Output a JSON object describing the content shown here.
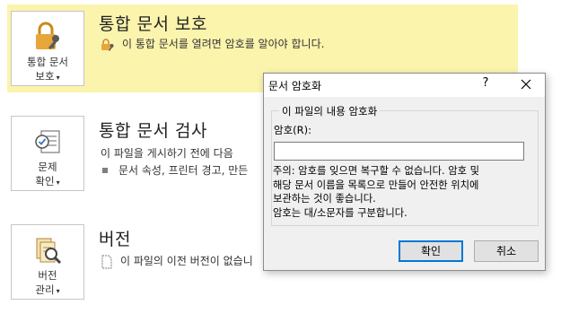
{
  "protect": {
    "tile_line1": "통합 문서",
    "tile_line2": "보호",
    "title": "통합 문서 보호",
    "description": "이 통합 문서를 열려면 암호를 알아야 합니다."
  },
  "inspect": {
    "tile_line1": "문제",
    "tile_line2": "확인",
    "title": "통합 문서 검사",
    "description": "이 파일을 게시하기 전에 다음",
    "bullet": "문서 속성, 프린터 경고, 만든"
  },
  "versions": {
    "tile_line1": "버전",
    "tile_line2": "관리",
    "title": "버전",
    "description": "이 파일의 이전 버전이 없습니"
  },
  "caret": "▾",
  "dialog": {
    "title": "문서 암호화",
    "help": "?",
    "group_label": "이 파일의 내용 암호화",
    "password_label": "암호(R):",
    "password_value": "",
    "note_line1": "주의: 암호를 잊으면 복구할 수 없습니다. 암호 및",
    "note_line2": "해당 문서 이름을 목록으로 만들어 안전한 위치에",
    "note_line3": "보관하는 것이 좋습니다.",
    "note_line4": "암호는 대/소문자를 구분합니다.",
    "ok": "확인",
    "cancel": "취소"
  },
  "colors": {
    "highlight_band": "#fbf4ad",
    "lock_icon": "#e0a030",
    "dialog_bg": "#f0f0f0",
    "primary_border": "#0078d7"
  },
  "icons": {
    "protect": "lock-key-icon",
    "inspect": "checklist-icon",
    "versions": "file-search-icon",
    "dialog_close": "close-icon"
  }
}
